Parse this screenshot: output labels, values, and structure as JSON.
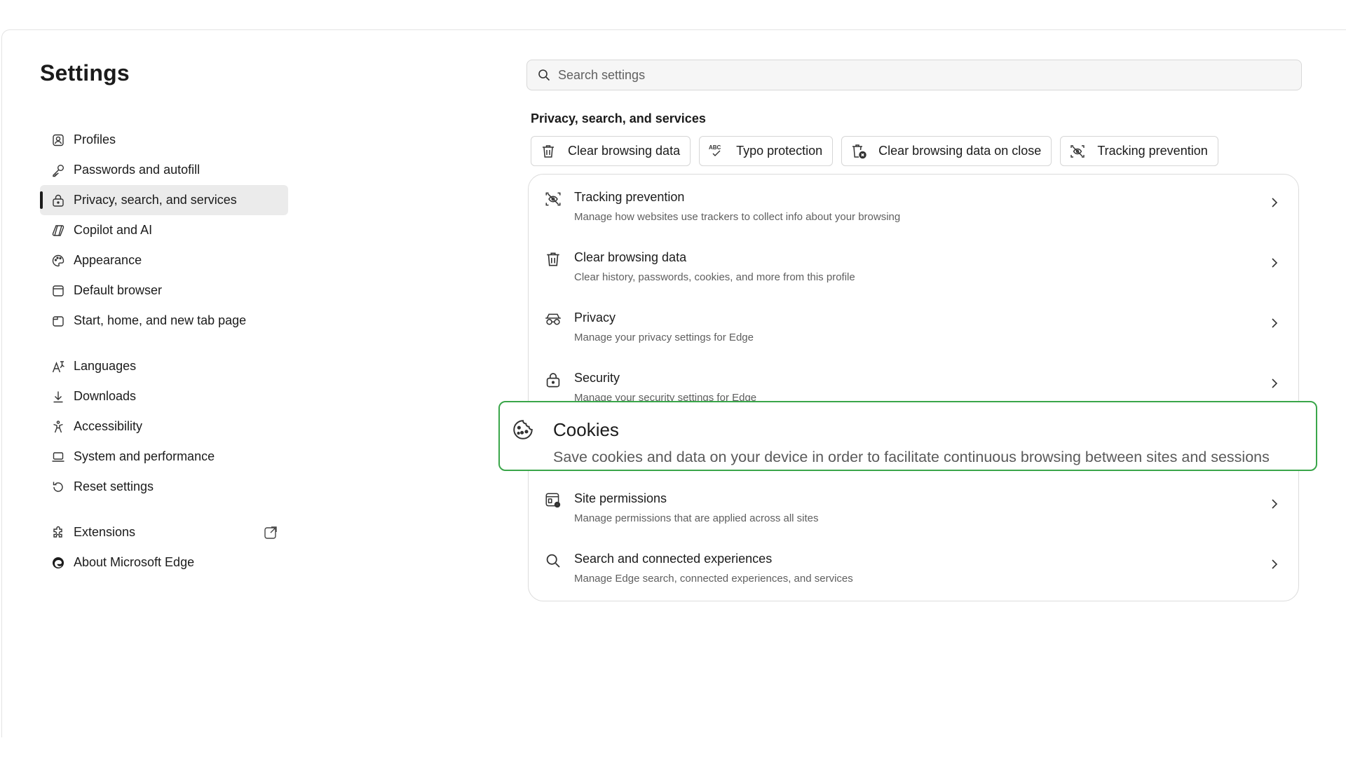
{
  "page_title": "Settings",
  "sidebar": {
    "items": [
      {
        "label": "Profiles",
        "icon": "profile-icon"
      },
      {
        "label": "Passwords and autofill",
        "icon": "key-icon"
      },
      {
        "label": "Privacy, search, and services",
        "icon": "lock-icon",
        "active": true
      },
      {
        "label": "Copilot and AI",
        "icon": "copilot-icon"
      },
      {
        "label": "Appearance",
        "icon": "palette-icon"
      },
      {
        "label": "Default browser",
        "icon": "browser-icon"
      },
      {
        "label": "Start, home, and new tab page",
        "icon": "home-tab-icon"
      },
      {
        "label": "Languages",
        "icon": "languages-icon"
      },
      {
        "label": "Downloads",
        "icon": "download-icon"
      },
      {
        "label": "Accessibility",
        "icon": "accessibility-icon"
      },
      {
        "label": "System and performance",
        "icon": "laptop-icon"
      },
      {
        "label": "Reset settings",
        "icon": "reset-icon"
      },
      {
        "label": "Extensions",
        "icon": "extensions-icon"
      },
      {
        "label": "About Microsoft Edge",
        "icon": "edge-logo-icon"
      }
    ]
  },
  "search": {
    "placeholder": "Search settings"
  },
  "main": {
    "section_title": "Privacy, search, and services",
    "chips": [
      {
        "label": "Clear browsing data",
        "icon": "trash-icon"
      },
      {
        "label": "Typo protection",
        "icon": "abc-check-icon"
      },
      {
        "label": "Clear browsing data on close",
        "icon": "trash-close-icon"
      },
      {
        "label": "Tracking prevention",
        "icon": "tracking-icon"
      }
    ],
    "rows": [
      {
        "title": "Tracking prevention",
        "desc": "Manage how websites use trackers to collect info about your browsing",
        "icon": "tracking-icon"
      },
      {
        "title": "Clear browsing data",
        "desc": "Clear history, passwords, cookies, and more from this profile",
        "icon": "trash-icon"
      },
      {
        "title": "Privacy",
        "desc": "Manage your privacy settings for Edge",
        "icon": "glasses-icon"
      },
      {
        "title": "Security",
        "desc": "Manage your security settings for Edge",
        "icon": "lock-icon"
      },
      {
        "title": "Site permissions",
        "desc": "Manage permissions that are applied across all sites",
        "icon": "site-permissions-icon"
      },
      {
        "title": "Search and connected experiences",
        "desc": "Manage Edge search, connected experiences, and services",
        "icon": "search-icon"
      }
    ],
    "highlight": {
      "title": "Cookies",
      "desc": "Save cookies and data on your device in order to facilitate continuous browsing between sites and sessions",
      "icon": "cookie-icon",
      "border_color": "#3aa64a"
    }
  }
}
